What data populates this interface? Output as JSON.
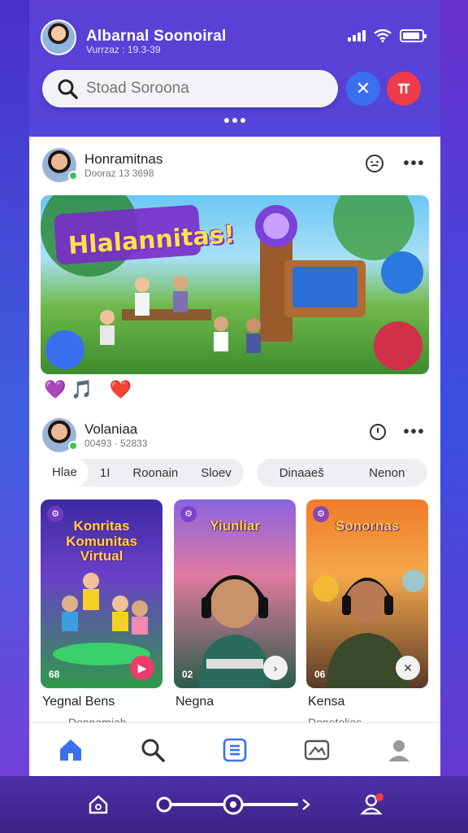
{
  "header": {
    "title": "Albarnal Soonoiral",
    "subtitle": "Vurrzaz : 19.3-39"
  },
  "search": {
    "placeholder": "Stoad Soroona"
  },
  "colors": {
    "accent_blue": "#3a6ff0",
    "accent_red": "#ef3b4a",
    "brand_purple": "#5b3fd6"
  },
  "posts": [
    {
      "author": "Honramitnas",
      "time": "Dooraz 13 3698",
      "banner_title": "Hlalannitas!",
      "reactions": [
        "💜",
        "🎵",
        "❤️"
      ]
    },
    {
      "author": "Volaniaa",
      "time": "00493 · 52833"
    }
  ],
  "chips_left": [
    "Hlae",
    "1I",
    "Roonain",
    "Sloev"
  ],
  "chips_right": [
    "Dinaaeš",
    "Nenon"
  ],
  "cards": [
    {
      "title": "Konritas Komunitas Virtual",
      "count": "68",
      "label": "Yegnal Bens",
      "sub": "Donnamiah"
    },
    {
      "title": "Yiunliar",
      "count": "02",
      "label": "Negna",
      "sub": ""
    },
    {
      "title": "Sonornas",
      "count": "06",
      "label": "Kensa",
      "sub": "Donetolias"
    }
  ],
  "nav": [
    "home-icon",
    "search-icon",
    "list-icon",
    "image-icon",
    "profile-icon"
  ]
}
